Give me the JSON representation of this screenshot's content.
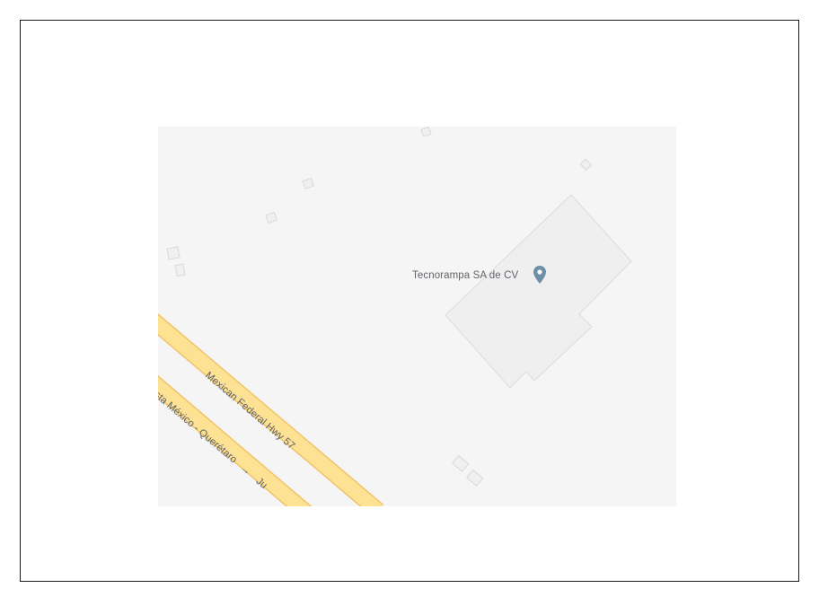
{
  "map": {
    "poi": {
      "name": "Tecnorampa SA de CV",
      "icon": "map-pin-icon",
      "pin_color": "#6f8fa6"
    },
    "roads": [
      {
        "name": "Mexican Federal Hwy 57"
      },
      {
        "name": "ista México - Querétaro",
        "direction_arrow": "→",
        "suffix": "Ju"
      }
    ],
    "colors": {
      "background": "#f5f5f5",
      "building_fill": "#efeff0",
      "building_stroke": "#dcdcdc",
      "road_fill": "#fde293",
      "road_stroke": "#f0c36a",
      "label_color": "#5f6368"
    }
  }
}
